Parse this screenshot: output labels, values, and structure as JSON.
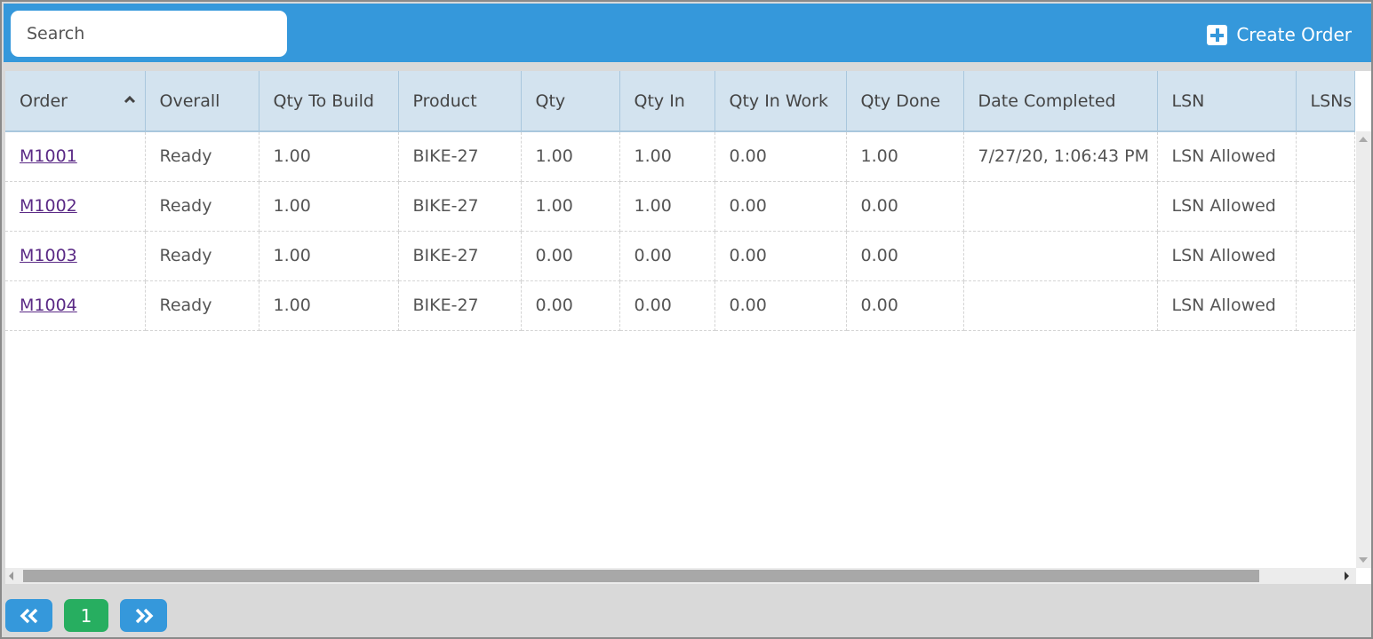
{
  "toolbar": {
    "search_placeholder": "Search",
    "search_value": "",
    "create_label": "Create Order",
    "create_icon": "plus-square-icon"
  },
  "colors": {
    "toolbar_bg": "#3598db",
    "header_bg": "#d3e3ef",
    "link": "#5b2a86",
    "page_active": "#27ae60",
    "page_nav": "#3598db"
  },
  "table": {
    "sort_column": "Order",
    "sort_direction": "ascending",
    "columns": [
      "Order",
      "Overall",
      "Qty To Build",
      "Product",
      "Qty",
      "Qty In",
      "Qty In Work",
      "Qty Done",
      "Date Completed",
      "LSN",
      "LSNs"
    ],
    "rows": [
      [
        "M1001",
        "Ready",
        "1.00",
        "BIKE-27",
        "1.00",
        "1.00",
        "0.00",
        "1.00",
        "7/27/20, 1:06:43 PM",
        "LSN Allowed",
        ""
      ],
      [
        "M1002",
        "Ready",
        "1.00",
        "BIKE-27",
        "1.00",
        "1.00",
        "0.00",
        "0.00",
        "",
        "LSN Allowed",
        ""
      ],
      [
        "M1003",
        "Ready",
        "1.00",
        "BIKE-27",
        "0.00",
        "0.00",
        "0.00",
        "0.00",
        "",
        "LSN Allowed",
        ""
      ],
      [
        "M1004",
        "Ready",
        "1.00",
        "BIKE-27",
        "0.00",
        "0.00",
        "0.00",
        "0.00",
        "",
        "LSN Allowed",
        ""
      ]
    ]
  },
  "pagination": {
    "prev_icon": "double-chevron-left-icon",
    "current_page": "1",
    "next_icon": "double-chevron-right-icon"
  }
}
